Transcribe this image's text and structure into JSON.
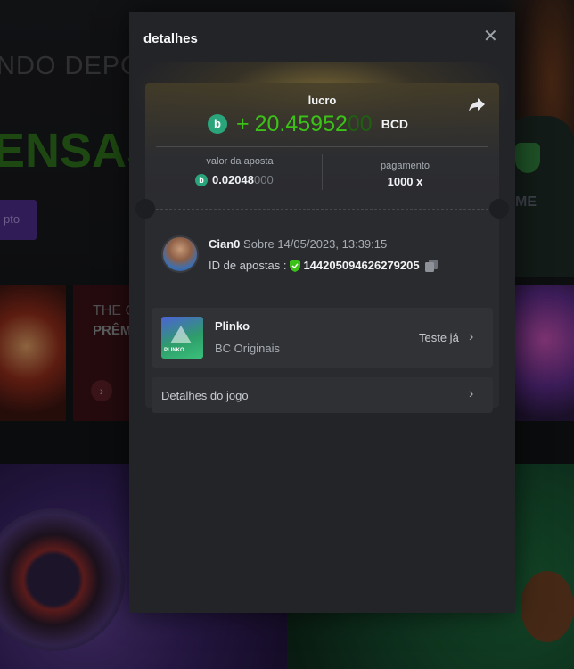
{
  "background": {
    "hero_line1": "NDO DEPÓ",
    "hero_line2": "ENSAS",
    "hero_button": "pto",
    "shirt_text": "ME",
    "promo_line1": "THE C",
    "promo_line2": "PRÊM"
  },
  "modal": {
    "title": "detalhes",
    "close_icon": "close-icon",
    "profit": {
      "label": "lucro",
      "sign": "+",
      "value_main": "20.45952",
      "value_dim": "00",
      "currency": "BCD",
      "coin_glyph": "b"
    },
    "bet": {
      "label": "valor da aposta",
      "value_main": "0.02048",
      "value_dim": "000"
    },
    "payout": {
      "label": "pagamento",
      "value": "1000 x"
    },
    "user": {
      "name": "Cian0",
      "date_text": "Sobre 14/05/2023, 13:39:15",
      "betid_label": "ID de apostas :",
      "betid_value": "144205094626279205"
    },
    "game": {
      "name": "Plinko",
      "provider": "BC Originais",
      "thumb_label": "PLINKO",
      "try_label": "Teste já"
    },
    "details_label": "Detalhes do jogo"
  },
  "colors": {
    "profit_green": "#3bc117",
    "coin_teal": "#2aa57b",
    "modal_bg": "#232428"
  }
}
